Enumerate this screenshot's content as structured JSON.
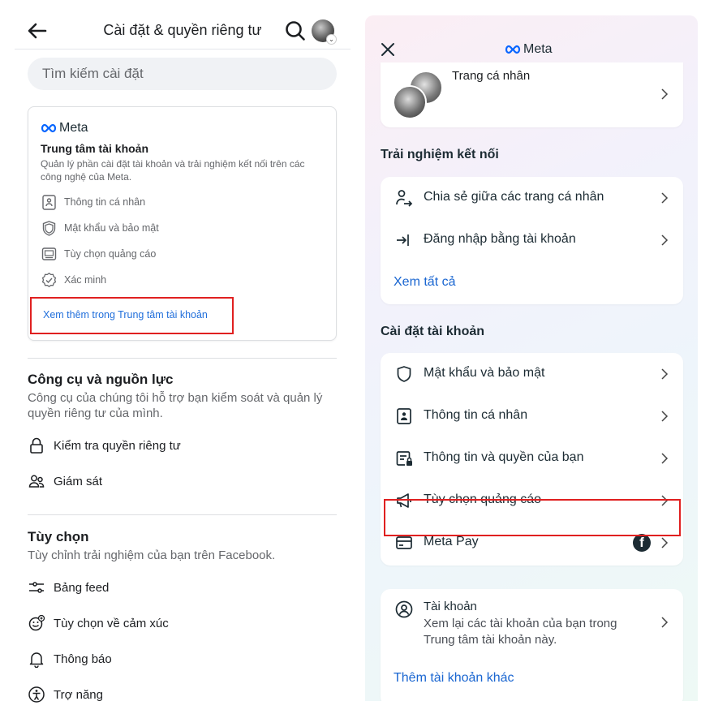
{
  "left": {
    "header": {
      "title": "Cài đặt & quyền riêng tư"
    },
    "search": {
      "placeholder": "Tìm kiếm cài đặt"
    },
    "accounts_center": {
      "brand": "Meta",
      "title": "Trung tâm tài khoản",
      "description": "Quản lý phần cài đặt tài khoản và trải nghiệm kết nối trên các công nghệ của Meta.",
      "items": [
        {
          "label": "Thông tin cá nhân",
          "icon": "id-card-icon"
        },
        {
          "label": "Mật khẩu và bảo mật",
          "icon": "shield-icon"
        },
        {
          "label": "Tùy chọn quảng cáo",
          "icon": "ad-screen-icon"
        },
        {
          "label": "Xác minh",
          "icon": "verified-badge-icon"
        }
      ],
      "see_more": "Xem thêm trong Trung tâm tài khoản"
    },
    "tools": {
      "title": "Công cụ và nguồn lực",
      "description": "Công cụ của chúng tôi hỗ trợ bạn kiểm soát và quản lý quyền riêng tư của mình.",
      "items": [
        {
          "label": "Kiểm tra quyền riêng tư",
          "icon": "lock-icon"
        },
        {
          "label": "Giám sát",
          "icon": "people-icon"
        }
      ]
    },
    "preferences": {
      "title": "Tùy chọn",
      "description": "Tùy chỉnh trải nghiệm của bạn trên Facebook.",
      "items": [
        {
          "label": "Bảng feed",
          "icon": "sliders-icon"
        },
        {
          "label": "Tùy chọn về cảm xúc",
          "icon": "reaction-icon"
        },
        {
          "label": "Thông báo",
          "icon": "bell-icon"
        },
        {
          "label": "Trợ năng",
          "icon": "accessibility-icon"
        }
      ]
    }
  },
  "right": {
    "header": {
      "brand": "Meta"
    },
    "profile": {
      "label": "Trang cá nhân"
    },
    "connected": {
      "title": "Trải nghiệm kết nối",
      "items": [
        {
          "label": "Chia sẻ giữa các trang cá nhân",
          "icon": "share-profiles-icon"
        },
        {
          "label": "Đăng nhập bằng tài khoản",
          "icon": "login-arrow-icon"
        }
      ],
      "see_all": "Xem tất cả"
    },
    "account_settings": {
      "title": "Cài đặt tài khoản",
      "items": [
        {
          "label": "Mật khẩu và bảo mật",
          "icon": "shield-icon"
        },
        {
          "label": "Thông tin cá nhân",
          "icon": "id-card-icon"
        },
        {
          "label": "Thông tin và quyền của bạn",
          "icon": "info-lock-icon"
        },
        {
          "label": "Tùy chọn quảng cáo",
          "icon": "megaphone-icon"
        },
        {
          "label": "Meta Pay",
          "icon": "card-icon"
        }
      ]
    },
    "accounts": {
      "title": "Tài khoản",
      "description": "Xem lại các tài khoản của bạn trong Trung tâm tài khoản này.",
      "add_link": "Thêm tài khoản khác"
    }
  },
  "colors": {
    "link": "#216fdb",
    "highlight": "#e02020",
    "text": "#1c1e21",
    "muted": "#65676b"
  }
}
